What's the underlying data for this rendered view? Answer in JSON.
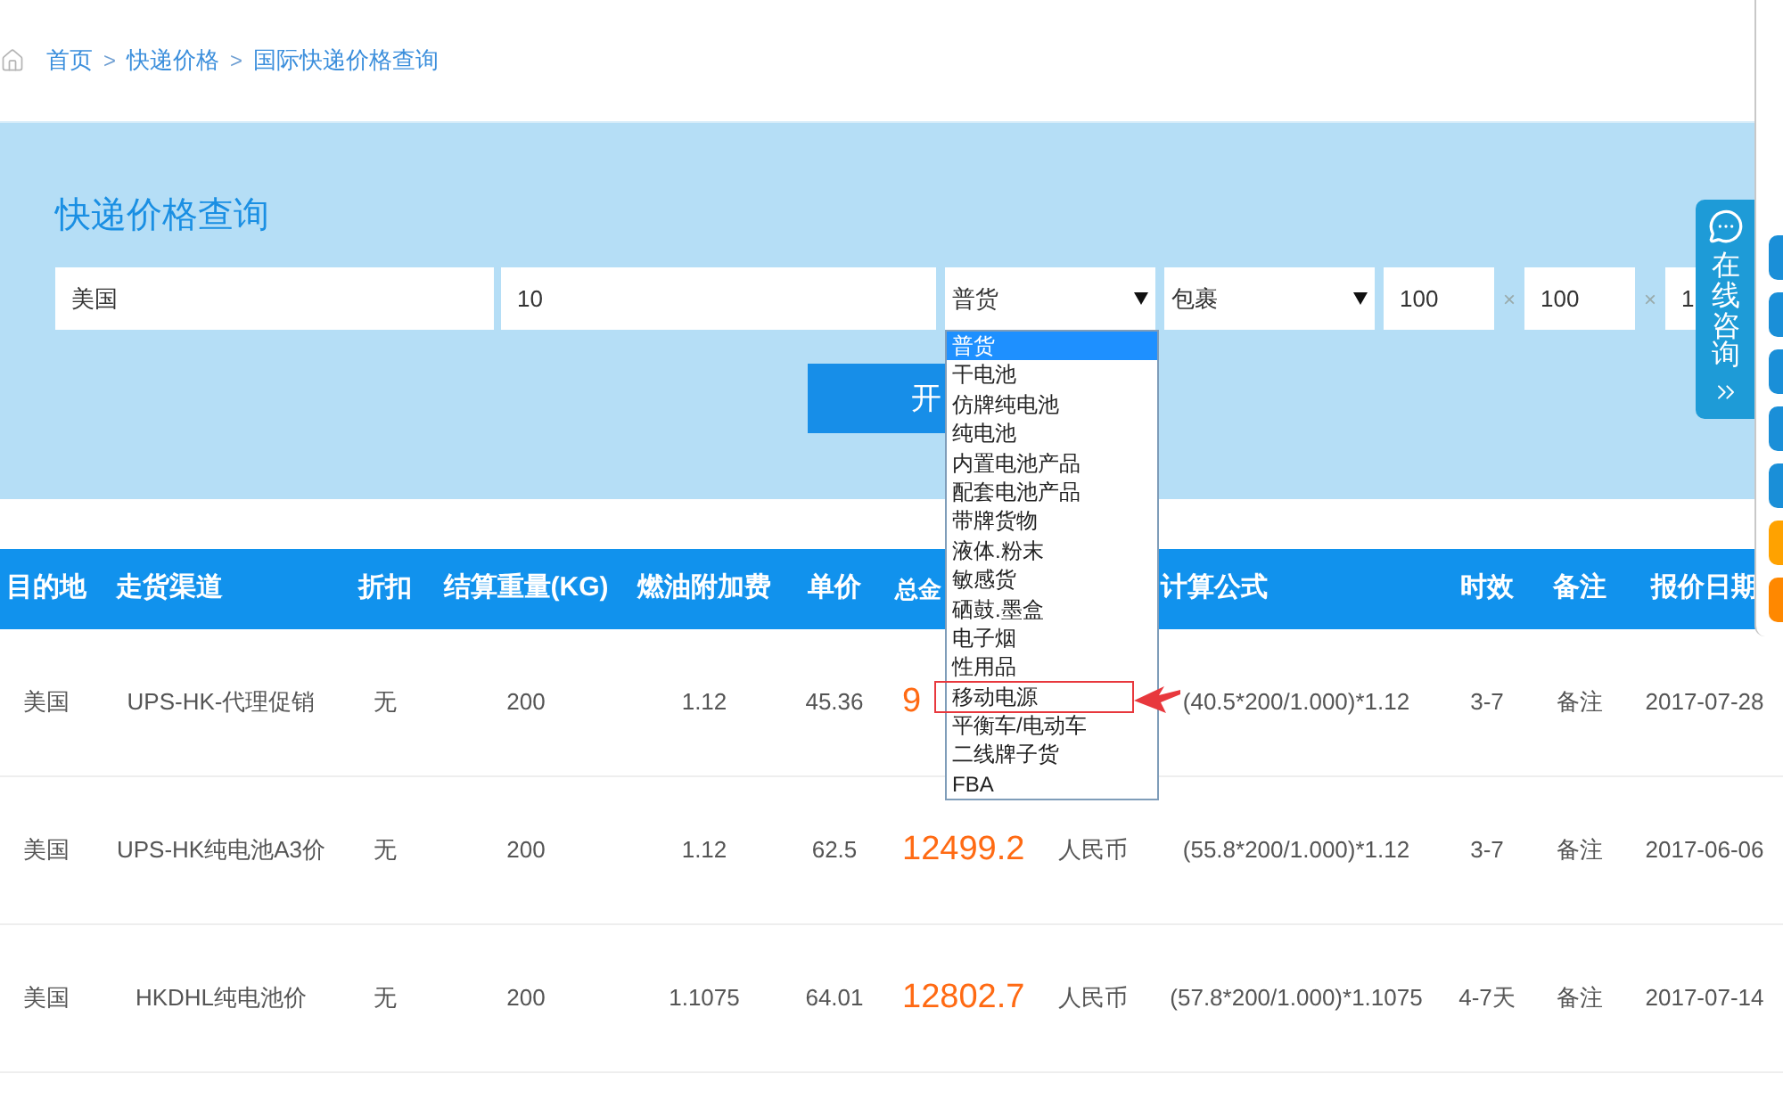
{
  "breadcrumb": [
    {
      "kind": "link",
      "text": "首页"
    },
    {
      "kind": "separator",
      "text": ">"
    },
    {
      "kind": "link",
      "text": "快递价格"
    },
    {
      "kind": "separator",
      "text": ">"
    },
    {
      "kind": "link",
      "text": "国际快递价格查询"
    }
  ],
  "search_panel": {
    "title": "快递价格查询",
    "fields": [
      {
        "kind": "input",
        "value": "美国"
      },
      {
        "kind": "input",
        "value": "10"
      },
      {
        "kind": "select",
        "value": "普货",
        "expanded": true,
        "options": [
          {
            "text": "普货",
            "selected": true,
            "marked": false
          },
          {
            "text": "干电池",
            "selected": false,
            "marked": false
          },
          {
            "text": "仿牌纯电池",
            "selected": false,
            "marked": false
          },
          {
            "text": "纯电池",
            "selected": false,
            "marked": false
          },
          {
            "text": "内置电池产品",
            "selected": false,
            "marked": false
          },
          {
            "text": "配套电池产品",
            "selected": false,
            "marked": false
          },
          {
            "text": "带牌货物",
            "selected": false,
            "marked": false
          },
          {
            "text": "液体.粉末",
            "selected": false,
            "marked": false
          },
          {
            "text": "敏感货",
            "selected": false,
            "marked": false
          },
          {
            "text": "硒鼓.墨盒",
            "selected": false,
            "marked": false
          },
          {
            "text": "电子烟",
            "selected": false,
            "marked": false
          },
          {
            "text": "性用品",
            "selected": false,
            "marked": false
          },
          {
            "text": "移动电源",
            "selected": false,
            "marked": true
          },
          {
            "text": "平衡车/电动车",
            "selected": false,
            "marked": false
          },
          {
            "text": "二线牌子货",
            "selected": false,
            "marked": false
          },
          {
            "text": "FBA",
            "selected": false,
            "marked": false
          }
        ]
      },
      {
        "kind": "select",
        "value": "包裹",
        "expanded": false
      },
      {
        "kind": "input",
        "value": "100"
      },
      {
        "kind": "separator",
        "text": "×"
      },
      {
        "kind": "input",
        "value": "100"
      },
      {
        "kind": "separator",
        "text": "×"
      },
      {
        "kind": "input",
        "value": "1"
      }
    ],
    "submit_button": "开"
  },
  "table": {
    "header": {
      "destination": "目的地",
      "channel": "走货渠道",
      "discount": "折扣",
      "weight": "结算重量(KG)",
      "fuel_surcharge": "燃油附加费",
      "unit_price": "单价",
      "total": "总金",
      "formula": "计算公式",
      "transit_time": "时效",
      "remarks": "备注",
      "quote_date": "报价日期"
    },
    "rows": [
      {
        "destination": "美国",
        "channel": "UPS-HK-代理促销",
        "discount": "无",
        "weight": "200",
        "fuel_surcharge": "1.12",
        "unit_price": "45.36",
        "total": "9",
        "formula": "(40.5*200/1.000)*1.12",
        "transit_time": "3-7",
        "remarks": "备注",
        "quote_date": "2017-07-28"
      },
      {
        "destination": "美国",
        "channel": "UPS-HK纯电池A3价",
        "discount": "无",
        "weight": "200",
        "fuel_surcharge": "1.12",
        "unit_price": "62.5",
        "total": "12499.2",
        "currency": "人民币",
        "formula": "(55.8*200/1.000)*1.12",
        "transit_time": "3-7",
        "remarks": "备注",
        "quote_date": "2017-06-06"
      },
      {
        "destination": "美国",
        "channel": "HKDHL纯电池价",
        "discount": "无",
        "weight": "200",
        "fuel_surcharge": "1.1075",
        "unit_price": "64.01",
        "total": "12802.7",
        "currency": "人民币",
        "formula": "(57.8*200/1.000)*1.1075",
        "transit_time": "4-7天",
        "remarks": "备注",
        "quote_date": "2017-07-14"
      }
    ]
  },
  "consult_tab": {
    "text": "在线咨询"
  },
  "side_tabs": [
    {
      "color": "#1a8fd8"
    },
    {
      "color": "#1a8fd8"
    },
    {
      "color": "#1a8fd8"
    },
    {
      "color": "#1a8fd8"
    },
    {
      "color": "#1a8fd8"
    },
    {
      "color": "#ffa200"
    },
    {
      "color": "#ff8800"
    }
  ]
}
